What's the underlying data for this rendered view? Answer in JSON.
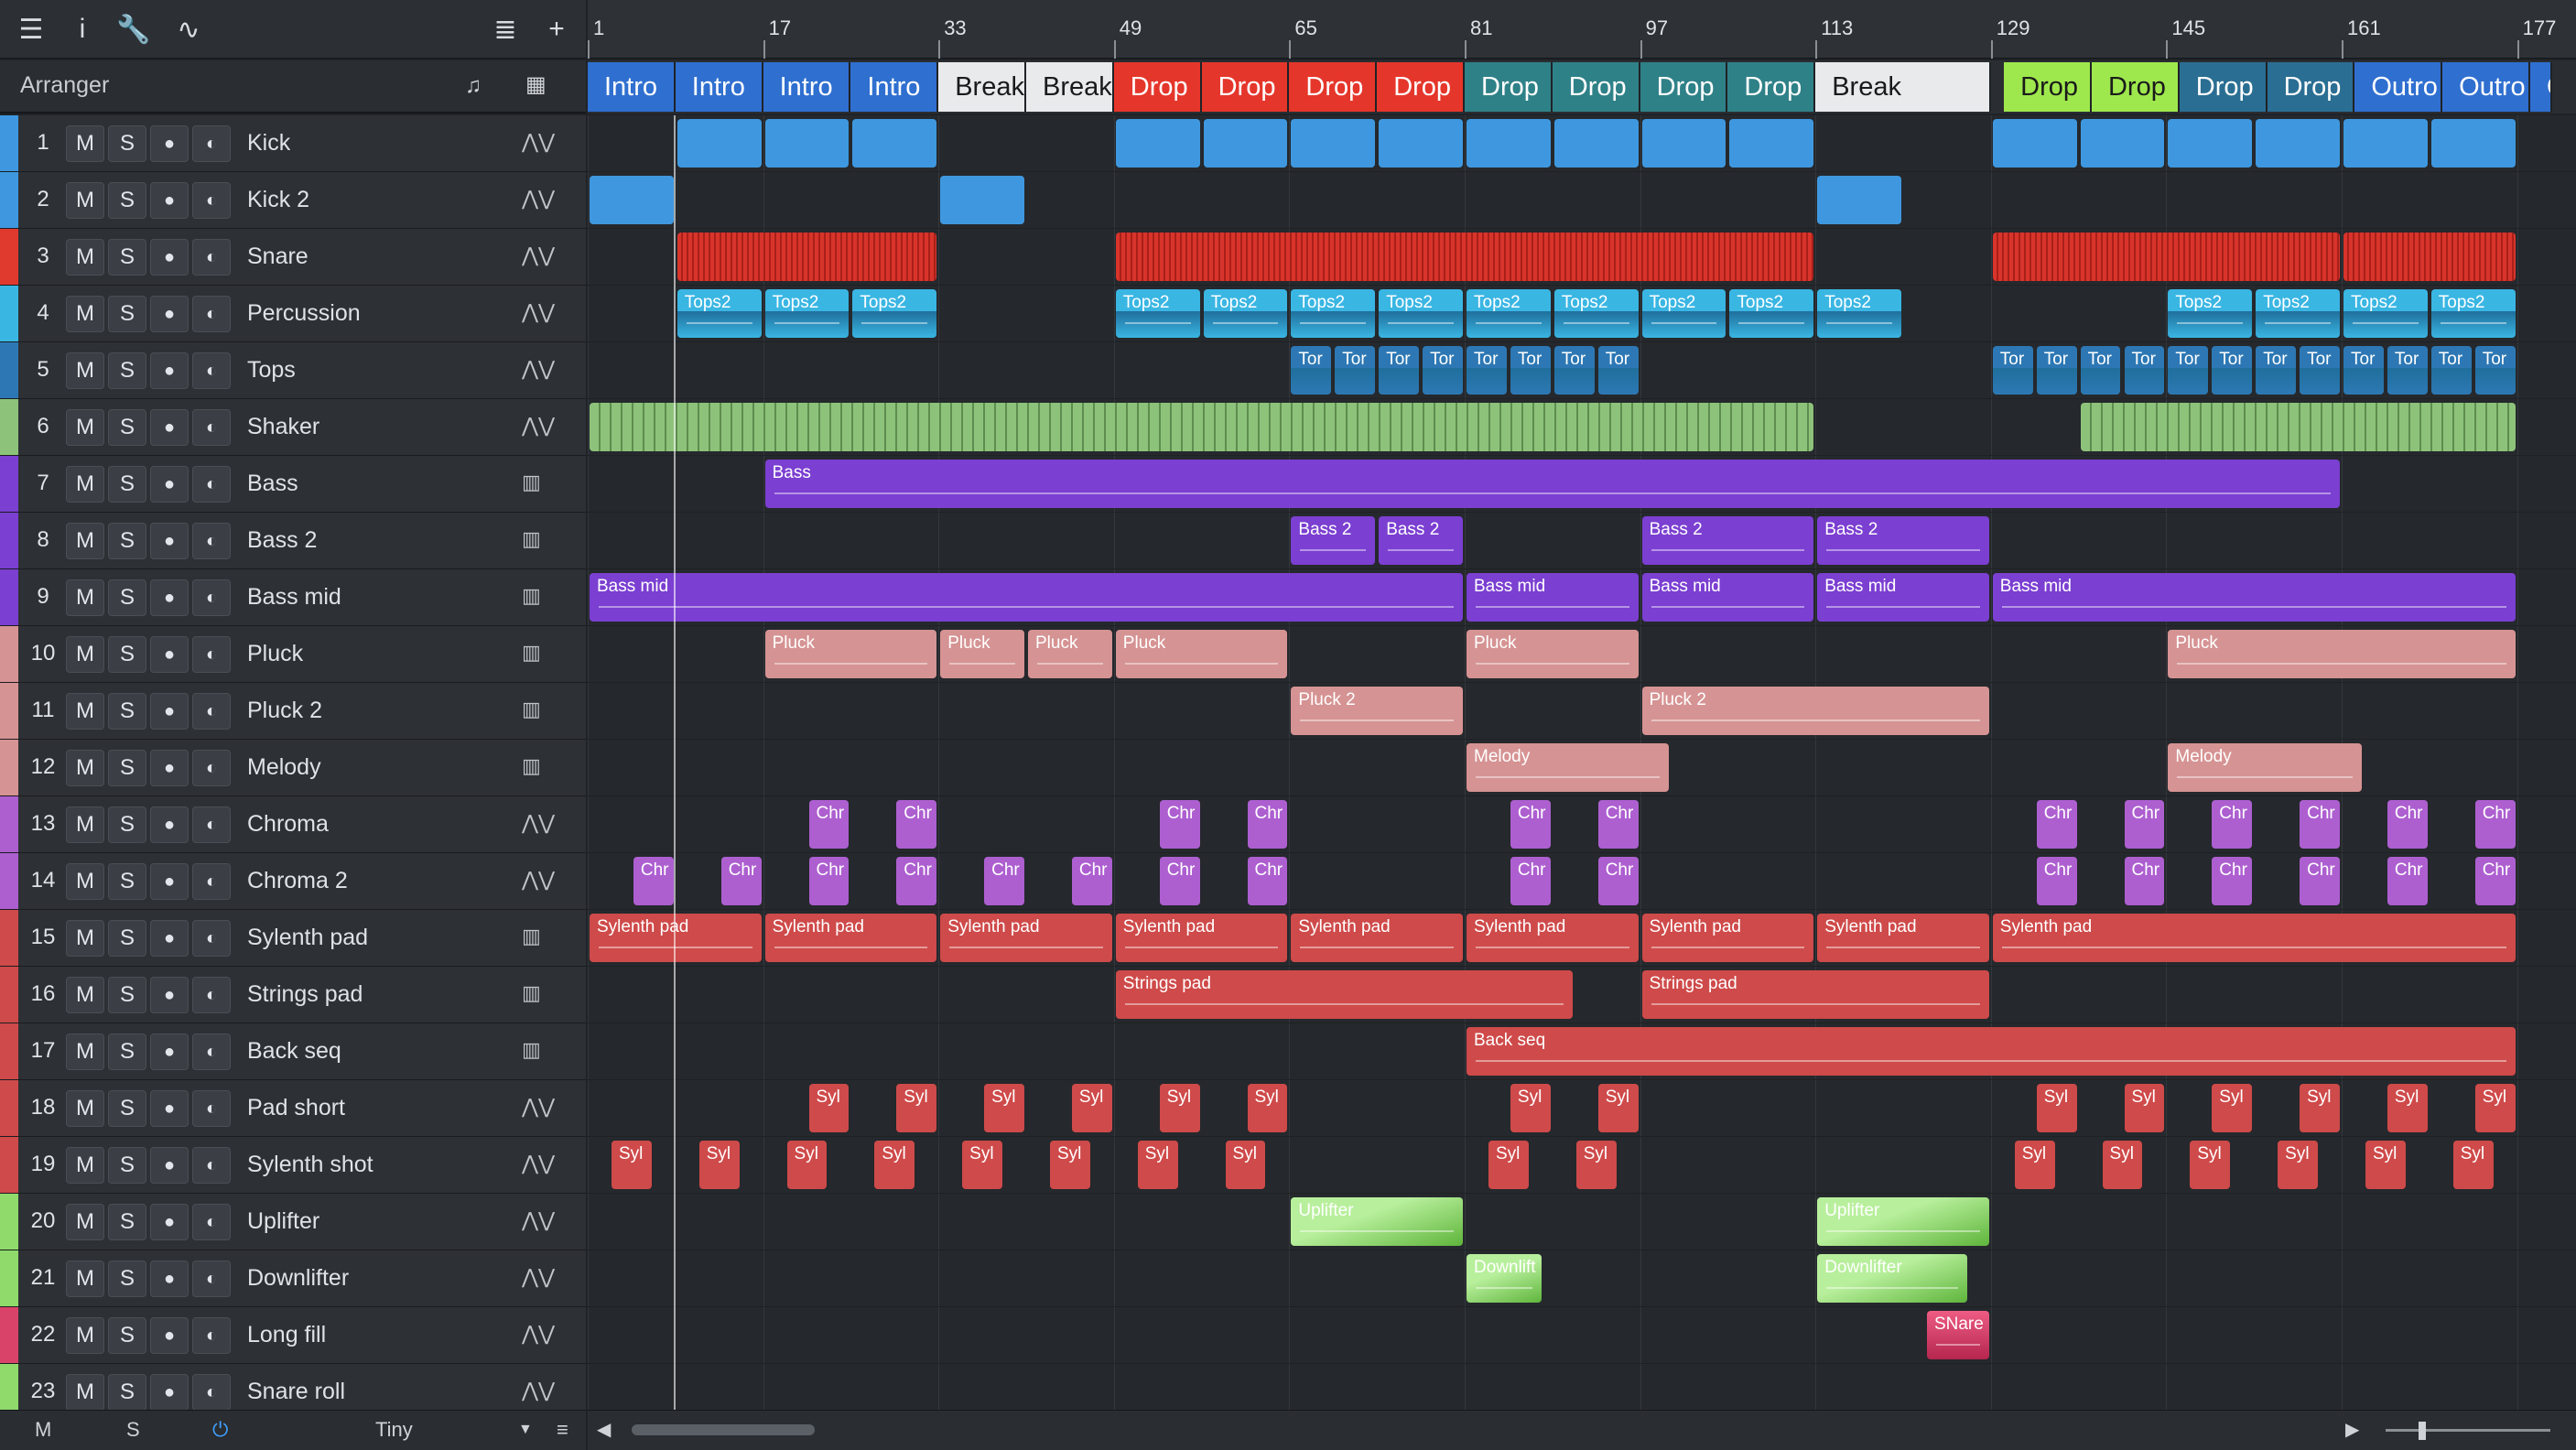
{
  "toolbar": {
    "icons": [
      "menu-icon",
      "info-icon",
      "wrench-icon",
      "automation-icon",
      "list-icon",
      "plus-icon"
    ]
  },
  "arranger": {
    "label": "Arranger"
  },
  "footer": {
    "m": "M",
    "s": "S",
    "size": "Tiny"
  },
  "ruler": {
    "bars": [
      "1",
      "17",
      "33",
      "49",
      "65",
      "81",
      "97",
      "113",
      "129",
      "145",
      "161",
      "177"
    ]
  },
  "sections": [
    {
      "label": "Intro",
      "color": "#2f6fd0"
    },
    {
      "label": "Intro",
      "color": "#2f6fd0"
    },
    {
      "label": "Intro",
      "color": "#2f6fd0"
    },
    {
      "label": "Intro",
      "color": "#2f6fd0"
    },
    {
      "label": "Break",
      "color": "#e9eaec"
    },
    {
      "label": "Break",
      "color": "#e9eaec"
    },
    {
      "label": "Drop",
      "color": "#e5362b"
    },
    {
      "label": "Drop",
      "color": "#e5362b"
    },
    {
      "label": "Drop",
      "color": "#e5362b"
    },
    {
      "label": "Drop",
      "color": "#e5362b"
    },
    {
      "label": "Drop",
      "color": "#2f8188"
    },
    {
      "label": "Drop",
      "color": "#2f8188"
    },
    {
      "label": "Drop",
      "color": "#2f8188"
    },
    {
      "label": "Drop",
      "color": "#2f8188"
    },
    {
      "label": "Break",
      "color": "#e9eaec"
    },
    {
      "label": "Drop",
      "color": "#9ee84d"
    },
    {
      "label": "Drop",
      "color": "#9ee84d"
    },
    {
      "label": "Drop",
      "color": "#2b6e93"
    },
    {
      "label": "Drop",
      "color": "#2b6e93"
    },
    {
      "label": "Outro",
      "color": "#2f6fd0"
    },
    {
      "label": "Outro",
      "color": "#2f6fd0"
    },
    {
      "label": "O",
      "color": "#2f6fd0"
    }
  ],
  "buttons": {
    "mute": "M",
    "solo": "S"
  },
  "tracks": [
    {
      "num": "1",
      "name": "Kick",
      "color": "#3f98df",
      "type": "audio"
    },
    {
      "num": "2",
      "name": "Kick 2",
      "color": "#3f98df",
      "type": "audio"
    },
    {
      "num": "3",
      "name": "Snare",
      "color": "#e03a2e",
      "type": "audio"
    },
    {
      "num": "4",
      "name": "Percussion",
      "color": "#3ab6e3",
      "type": "audio"
    },
    {
      "num": "5",
      "name": "Tops",
      "color": "#2d78b4",
      "type": "audio"
    },
    {
      "num": "6",
      "name": "Shaker",
      "color": "#8dc27a",
      "type": "audio"
    },
    {
      "num": "7",
      "name": "Bass",
      "color": "#7b3fd1",
      "type": "instrument"
    },
    {
      "num": "8",
      "name": "Bass 2",
      "color": "#7b3fd1",
      "type": "instrument"
    },
    {
      "num": "9",
      "name": "Bass mid",
      "color": "#7b3fd1",
      "type": "instrument"
    },
    {
      "num": "10",
      "name": "Pluck",
      "color": "#d69393",
      "type": "instrument"
    },
    {
      "num": "11",
      "name": "Pluck 2",
      "color": "#d69393",
      "type": "instrument"
    },
    {
      "num": "12",
      "name": "Melody",
      "color": "#d69393",
      "type": "instrument"
    },
    {
      "num": "13",
      "name": "Chroma",
      "color": "#ad5fd0",
      "type": "audio"
    },
    {
      "num": "14",
      "name": "Chroma 2",
      "color": "#ad5fd0",
      "type": "audio"
    },
    {
      "num": "15",
      "name": "Sylenth pad",
      "color": "#cf4a4a",
      "type": "instrument"
    },
    {
      "num": "16",
      "name": "Strings pad",
      "color": "#cf4a4a",
      "type": "instrument"
    },
    {
      "num": "17",
      "name": "Back seq",
      "color": "#cf4a4a",
      "type": "instrument"
    },
    {
      "num": "18",
      "name": "Pad short",
      "color": "#cf4a4a",
      "type": "audio"
    },
    {
      "num": "19",
      "name": "Sylenth shot",
      "color": "#cf4a4a",
      "type": "audio"
    },
    {
      "num": "20",
      "name": "Uplifter",
      "color": "#8fda6b",
      "type": "audio"
    },
    {
      "num": "21",
      "name": "Downlifter",
      "color": "#8fda6b",
      "type": "audio"
    },
    {
      "num": "22",
      "name": "Long fill",
      "color": "#d9436a",
      "type": "audio"
    },
    {
      "num": "23",
      "name": "Snare roll",
      "color": "#8fda6b",
      "type": "audio"
    }
  ],
  "clips": [
    {
      "t": 0,
      "label": "",
      "color": "#3f98df",
      "segs": [
        [
          2,
          4
        ],
        [
          4,
          6
        ],
        [
          6,
          8
        ],
        [
          12,
          14
        ],
        [
          14,
          16
        ],
        [
          16,
          18
        ],
        [
          18,
          20
        ],
        [
          20,
          22
        ],
        [
          22,
          24
        ],
        [
          24,
          26
        ],
        [
          26,
          28
        ],
        [
          32,
          34
        ],
        [
          34,
          36
        ],
        [
          36,
          38
        ],
        [
          38,
          40
        ],
        [
          40,
          42
        ],
        [
          42,
          44
        ]
      ]
    },
    {
      "t": 1,
      "label": "",
      "color": "#3f98df",
      "segs": [
        [
          0,
          2
        ],
        [
          8,
          10
        ],
        [
          28,
          30
        ]
      ]
    },
    {
      "t": 2,
      "label": "",
      "color": "#d8342b",
      "segs": [
        [
          2,
          8
        ],
        [
          12,
          28
        ],
        [
          32,
          40
        ],
        [
          40,
          44
        ]
      ]
    },
    {
      "t": 3,
      "label": "Tops2",
      "color": "#3ab6e3",
      "segs": [
        [
          2,
          4
        ],
        [
          4,
          6
        ],
        [
          6,
          8
        ],
        [
          12,
          14
        ],
        [
          14,
          16
        ],
        [
          16,
          18
        ],
        [
          18,
          20
        ],
        [
          20,
          22
        ],
        [
          22,
          24
        ],
        [
          24,
          26
        ],
        [
          26,
          28
        ],
        [
          28,
          30
        ],
        [
          36,
          38
        ],
        [
          38,
          40
        ],
        [
          40,
          42
        ],
        [
          42,
          44
        ]
      ]
    },
    {
      "t": 4,
      "label": "Tor",
      "color": "#2d78b4",
      "segs": [
        [
          16,
          17
        ],
        [
          17,
          18
        ],
        [
          18,
          19
        ],
        [
          19,
          20
        ],
        [
          20,
          21
        ],
        [
          21,
          22
        ],
        [
          22,
          23
        ],
        [
          23,
          24
        ],
        [
          32,
          33
        ],
        [
          33,
          34
        ],
        [
          34,
          35
        ],
        [
          35,
          36
        ],
        [
          36,
          37
        ],
        [
          37,
          38
        ],
        [
          38,
          39
        ],
        [
          39,
          40
        ],
        [
          40,
          41
        ],
        [
          41,
          42
        ],
        [
          42,
          43
        ],
        [
          43,
          44
        ]
      ]
    },
    {
      "t": 5,
      "label": "",
      "color": "#8dc27a",
      "segs": [
        [
          0,
          28
        ],
        [
          34,
          44
        ]
      ]
    },
    {
      "t": 6,
      "label": "Bass",
      "color": "#7b3fd1",
      "segs": [
        [
          4,
          40
        ]
      ]
    },
    {
      "t": 7,
      "label": "Bass 2",
      "color": "#7b3fd1",
      "segs": [
        [
          16,
          18
        ],
        [
          18,
          20
        ],
        [
          24,
          28
        ],
        [
          28,
          32
        ]
      ]
    },
    {
      "t": 8,
      "label": "Bass mid",
      "color": "#7b3fd1",
      "segs": [
        [
          0,
          20
        ],
        [
          20,
          24
        ],
        [
          24,
          28
        ],
        [
          28,
          32
        ],
        [
          32,
          44
        ]
      ]
    },
    {
      "t": 9,
      "label": "Pluck",
      "color": "#d69393",
      "segs": [
        [
          4,
          8
        ],
        [
          8,
          10
        ],
        [
          10,
          12
        ],
        [
          12,
          16
        ],
        [
          20,
          24
        ],
        [
          36,
          44
        ]
      ]
    },
    {
      "t": 10,
      "label": "Pluck 2",
      "color": "#d69393",
      "segs": [
        [
          16,
          20
        ],
        [
          24,
          32
        ]
      ]
    },
    {
      "t": 11,
      "label": "Melody",
      "color": "#d69393",
      "segs": [
        [
          20,
          24.7
        ],
        [
          36,
          40.5
        ]
      ]
    },
    {
      "t": 12,
      "label": "Chr",
      "color": "#ad5fd0",
      "segs": [
        [
          5,
          6
        ],
        [
          7,
          8
        ],
        [
          13,
          14
        ],
        [
          15,
          16
        ],
        [
          21,
          22
        ],
        [
          23,
          24
        ],
        [
          33,
          34
        ],
        [
          35,
          36
        ],
        [
          37,
          38
        ],
        [
          39,
          40
        ],
        [
          41,
          42
        ],
        [
          43,
          44
        ]
      ]
    },
    {
      "t": 13,
      "label": "Chr",
      "color": "#ad5fd0",
      "segs": [
        [
          1,
          2
        ],
        [
          3,
          4
        ],
        [
          5,
          6
        ],
        [
          7,
          8
        ],
        [
          9,
          10
        ],
        [
          11,
          12
        ],
        [
          13,
          14
        ],
        [
          15,
          16
        ],
        [
          21,
          22
        ],
        [
          23,
          24
        ],
        [
          33,
          34
        ],
        [
          35,
          36
        ],
        [
          37,
          38
        ],
        [
          39,
          40
        ],
        [
          41,
          42
        ],
        [
          43,
          44
        ]
      ]
    },
    {
      "t": 14,
      "label": "Sylenth pad",
      "color": "#cf4a4a",
      "segs": [
        [
          0,
          4
        ],
        [
          4,
          8
        ],
        [
          8,
          12
        ],
        [
          12,
          16
        ],
        [
          16,
          20
        ],
        [
          20,
          24
        ],
        [
          24,
          28
        ],
        [
          28,
          32
        ],
        [
          32,
          44
        ]
      ]
    },
    {
      "t": 15,
      "label": "Strings pad",
      "color": "#cf4a4a",
      "segs": [
        [
          12,
          22.5
        ],
        [
          24,
          32
        ]
      ]
    },
    {
      "t": 16,
      "label": "Back seq",
      "color": "#cf4a4a",
      "segs": [
        [
          20,
          44
        ]
      ]
    },
    {
      "t": 17,
      "label": "Syl",
      "color": "#cf4a4a",
      "segs": [
        [
          5,
          6
        ],
        [
          7,
          8
        ],
        [
          9,
          10
        ],
        [
          11,
          12
        ],
        [
          13,
          14
        ],
        [
          15,
          16
        ],
        [
          21,
          22
        ],
        [
          23,
          24
        ],
        [
          33,
          34
        ],
        [
          35,
          36
        ],
        [
          37,
          38
        ],
        [
          39,
          40
        ],
        [
          41,
          42
        ],
        [
          43,
          44
        ]
      ]
    },
    {
      "t": 18,
      "label": "Syl",
      "color": "#cf4a4a",
      "segs": [
        [
          0.5,
          1.5
        ],
        [
          2.5,
          3.5
        ],
        [
          4.5,
          5.5
        ],
        [
          6.5,
          7.5
        ],
        [
          8.5,
          9.5
        ],
        [
          10.5,
          11.5
        ],
        [
          12.5,
          13.5
        ],
        [
          14.5,
          15.5
        ],
        [
          20.5,
          21.5
        ],
        [
          22.5,
          23.5
        ],
        [
          32.5,
          33.5
        ],
        [
          34.5,
          35.5
        ],
        [
          36.5,
          37.5
        ],
        [
          38.5,
          39.5
        ],
        [
          40.5,
          41.5
        ],
        [
          42.5,
          43.5
        ]
      ]
    },
    {
      "t": 19,
      "label": "Uplifter",
      "color": "#8fda6b",
      "segs": [
        [
          16,
          20
        ],
        [
          28,
          32
        ]
      ]
    },
    {
      "t": 20,
      "label": "Downlift",
      "color": "#8fda6b",
      "segs": [
        [
          20,
          21.8
        ]
      ]
    },
    {
      "t": 20,
      "label": "Downlifter",
      "color": "#8fda6b",
      "segs": [
        [
          28,
          31.5
        ]
      ]
    },
    {
      "t": 21,
      "label": "SNare",
      "color": "#d9436a",
      "segs": [
        [
          30.5,
          32
        ]
      ]
    }
  ]
}
